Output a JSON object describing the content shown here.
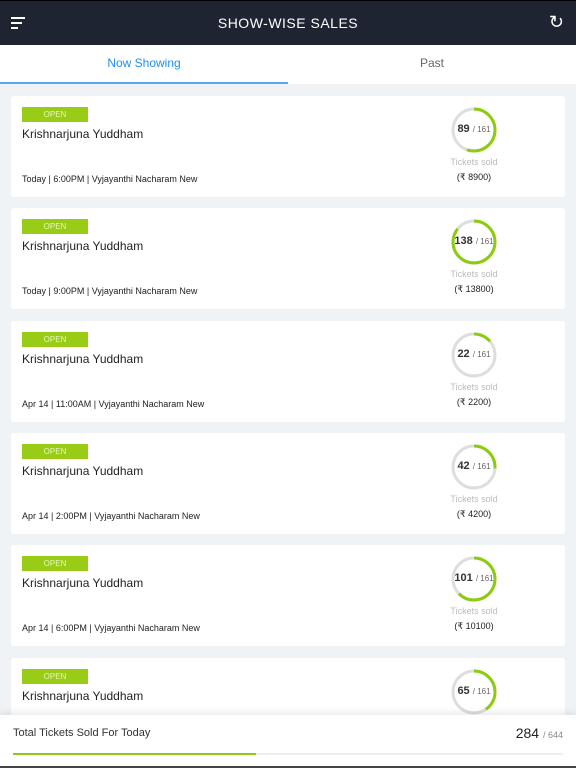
{
  "header": {
    "title": "SHOW-WISE SALES",
    "menu_icon": "menu-icon",
    "refresh_icon": "refresh-icon"
  },
  "tabs": [
    {
      "label": "Now Showing",
      "active": true
    },
    {
      "label": "Past",
      "active": false
    }
  ],
  "shows": [
    {
      "status": "OPEN",
      "title": "Krishnarjuna Yuddham",
      "meta": "Today | 6:00PM | Vyjayanthi Nacharam New",
      "sold": 89,
      "capacity": "/ 161",
      "sold_label": "Tickets sold",
      "amount": "(₹ 8900)"
    },
    {
      "status": "OPEN",
      "title": "Krishnarjuna Yuddham",
      "meta": "Today | 9:00PM | Vyjayanthi Nacharam New",
      "sold": 138,
      "capacity": "/ 161",
      "sold_label": "Tickets sold",
      "amount": "(₹ 13800)"
    },
    {
      "status": "OPEN",
      "title": "Krishnarjuna Yuddham",
      "meta": "Apr 14 | 11:00AM | Vyjayanthi Nacharam New",
      "sold": 22,
      "capacity": "/ 161",
      "sold_label": "Tickets sold",
      "amount": "(₹ 2200)"
    },
    {
      "status": "OPEN",
      "title": "Krishnarjuna Yuddham",
      "meta": "Apr 14 | 2:00PM | Vyjayanthi Nacharam New",
      "sold": 42,
      "capacity": "/ 161",
      "sold_label": "Tickets sold",
      "amount": "(₹ 4200)"
    },
    {
      "status": "OPEN",
      "title": "Krishnarjuna Yuddham",
      "meta": "Apr 14 | 6:00PM | Vyjayanthi Nacharam New",
      "sold": 101,
      "capacity": "/ 161",
      "sold_label": "Tickets sold",
      "amount": "(₹ 10100)"
    },
    {
      "status": "OPEN",
      "title": "Krishnarjuna Yuddham",
      "meta": "",
      "sold": 65,
      "capacity": "/ 161",
      "sold_label": "",
      "amount": ""
    }
  ],
  "footer": {
    "label": "Total Tickets Sold For Today",
    "sold": "284",
    "total": "/ 644",
    "progress": 0.441
  },
  "colors": {
    "header": "#1f2433",
    "accent": "#1e8ef0",
    "green": "#99cc16"
  }
}
